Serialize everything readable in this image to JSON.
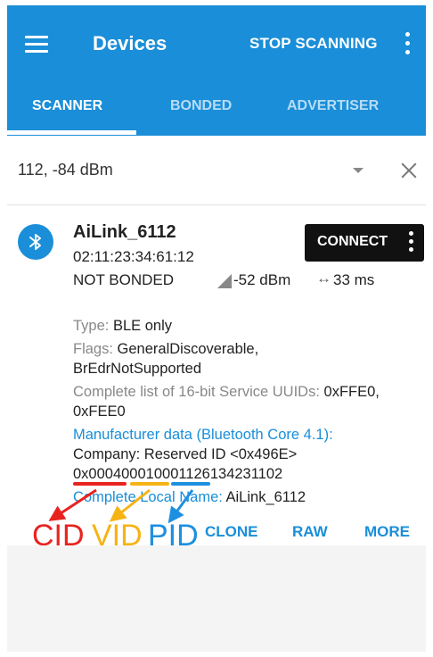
{
  "appbar": {
    "title": "Devices",
    "stop_label": "STOP SCANNING",
    "background": "#1a8ed8"
  },
  "tabs": [
    {
      "label": "SCANNER",
      "active": true
    },
    {
      "label": "BONDED",
      "active": false
    },
    {
      "label": "ADVERTISER",
      "active": false
    }
  ],
  "filter": {
    "text": "112, -84 dBm"
  },
  "device": {
    "name": "AiLink_6112",
    "address": "02:11:23:34:61:12",
    "bond_state": "NOT BONDED",
    "rssi": "-52 dBm",
    "interval": "33 ms",
    "connect_label": "CONNECT",
    "details": {
      "type_label": "Type: ",
      "type_value": "BLE only",
      "flags_label": "Flags: ",
      "flags_value_1": "GeneralDiscoverable,",
      "flags_value_2": "BrEdrNotSupported",
      "uuids_label": "Complete list of 16-bit Service UUIDs: ",
      "uuids_value_1": "0xFFE0,",
      "uuids_value_2": "0xFEE0",
      "manufacturer_label": "Manufacturer data (Bluetooth Core 4.1):",
      "company": "Company: Reserved ID <0x496E>",
      "manufacturer_data": "0x0004000100011261342311​02",
      "local_name_label": "Complete Local Name: ",
      "local_name_value": "AiLink_6112"
    },
    "actions": {
      "clone": "CLONE",
      "raw": "RAW",
      "more": "MORE"
    }
  },
  "annotations": {
    "cid": "CID",
    "vid": "VID",
    "pid": "PID",
    "colors": {
      "cid": "#e8231f",
      "vid": "#f5b314",
      "pid": "#1d8fe0"
    }
  },
  "icons": {
    "menu": "hamburger-menu-icon",
    "overflow": "overflow-menu-icon",
    "dropdown": "dropdown-triangle-icon",
    "clear": "close-icon",
    "bluetooth": "bluetooth-icon",
    "signal": "signal-strength-icon",
    "interval": "double-arrow-icon"
  }
}
